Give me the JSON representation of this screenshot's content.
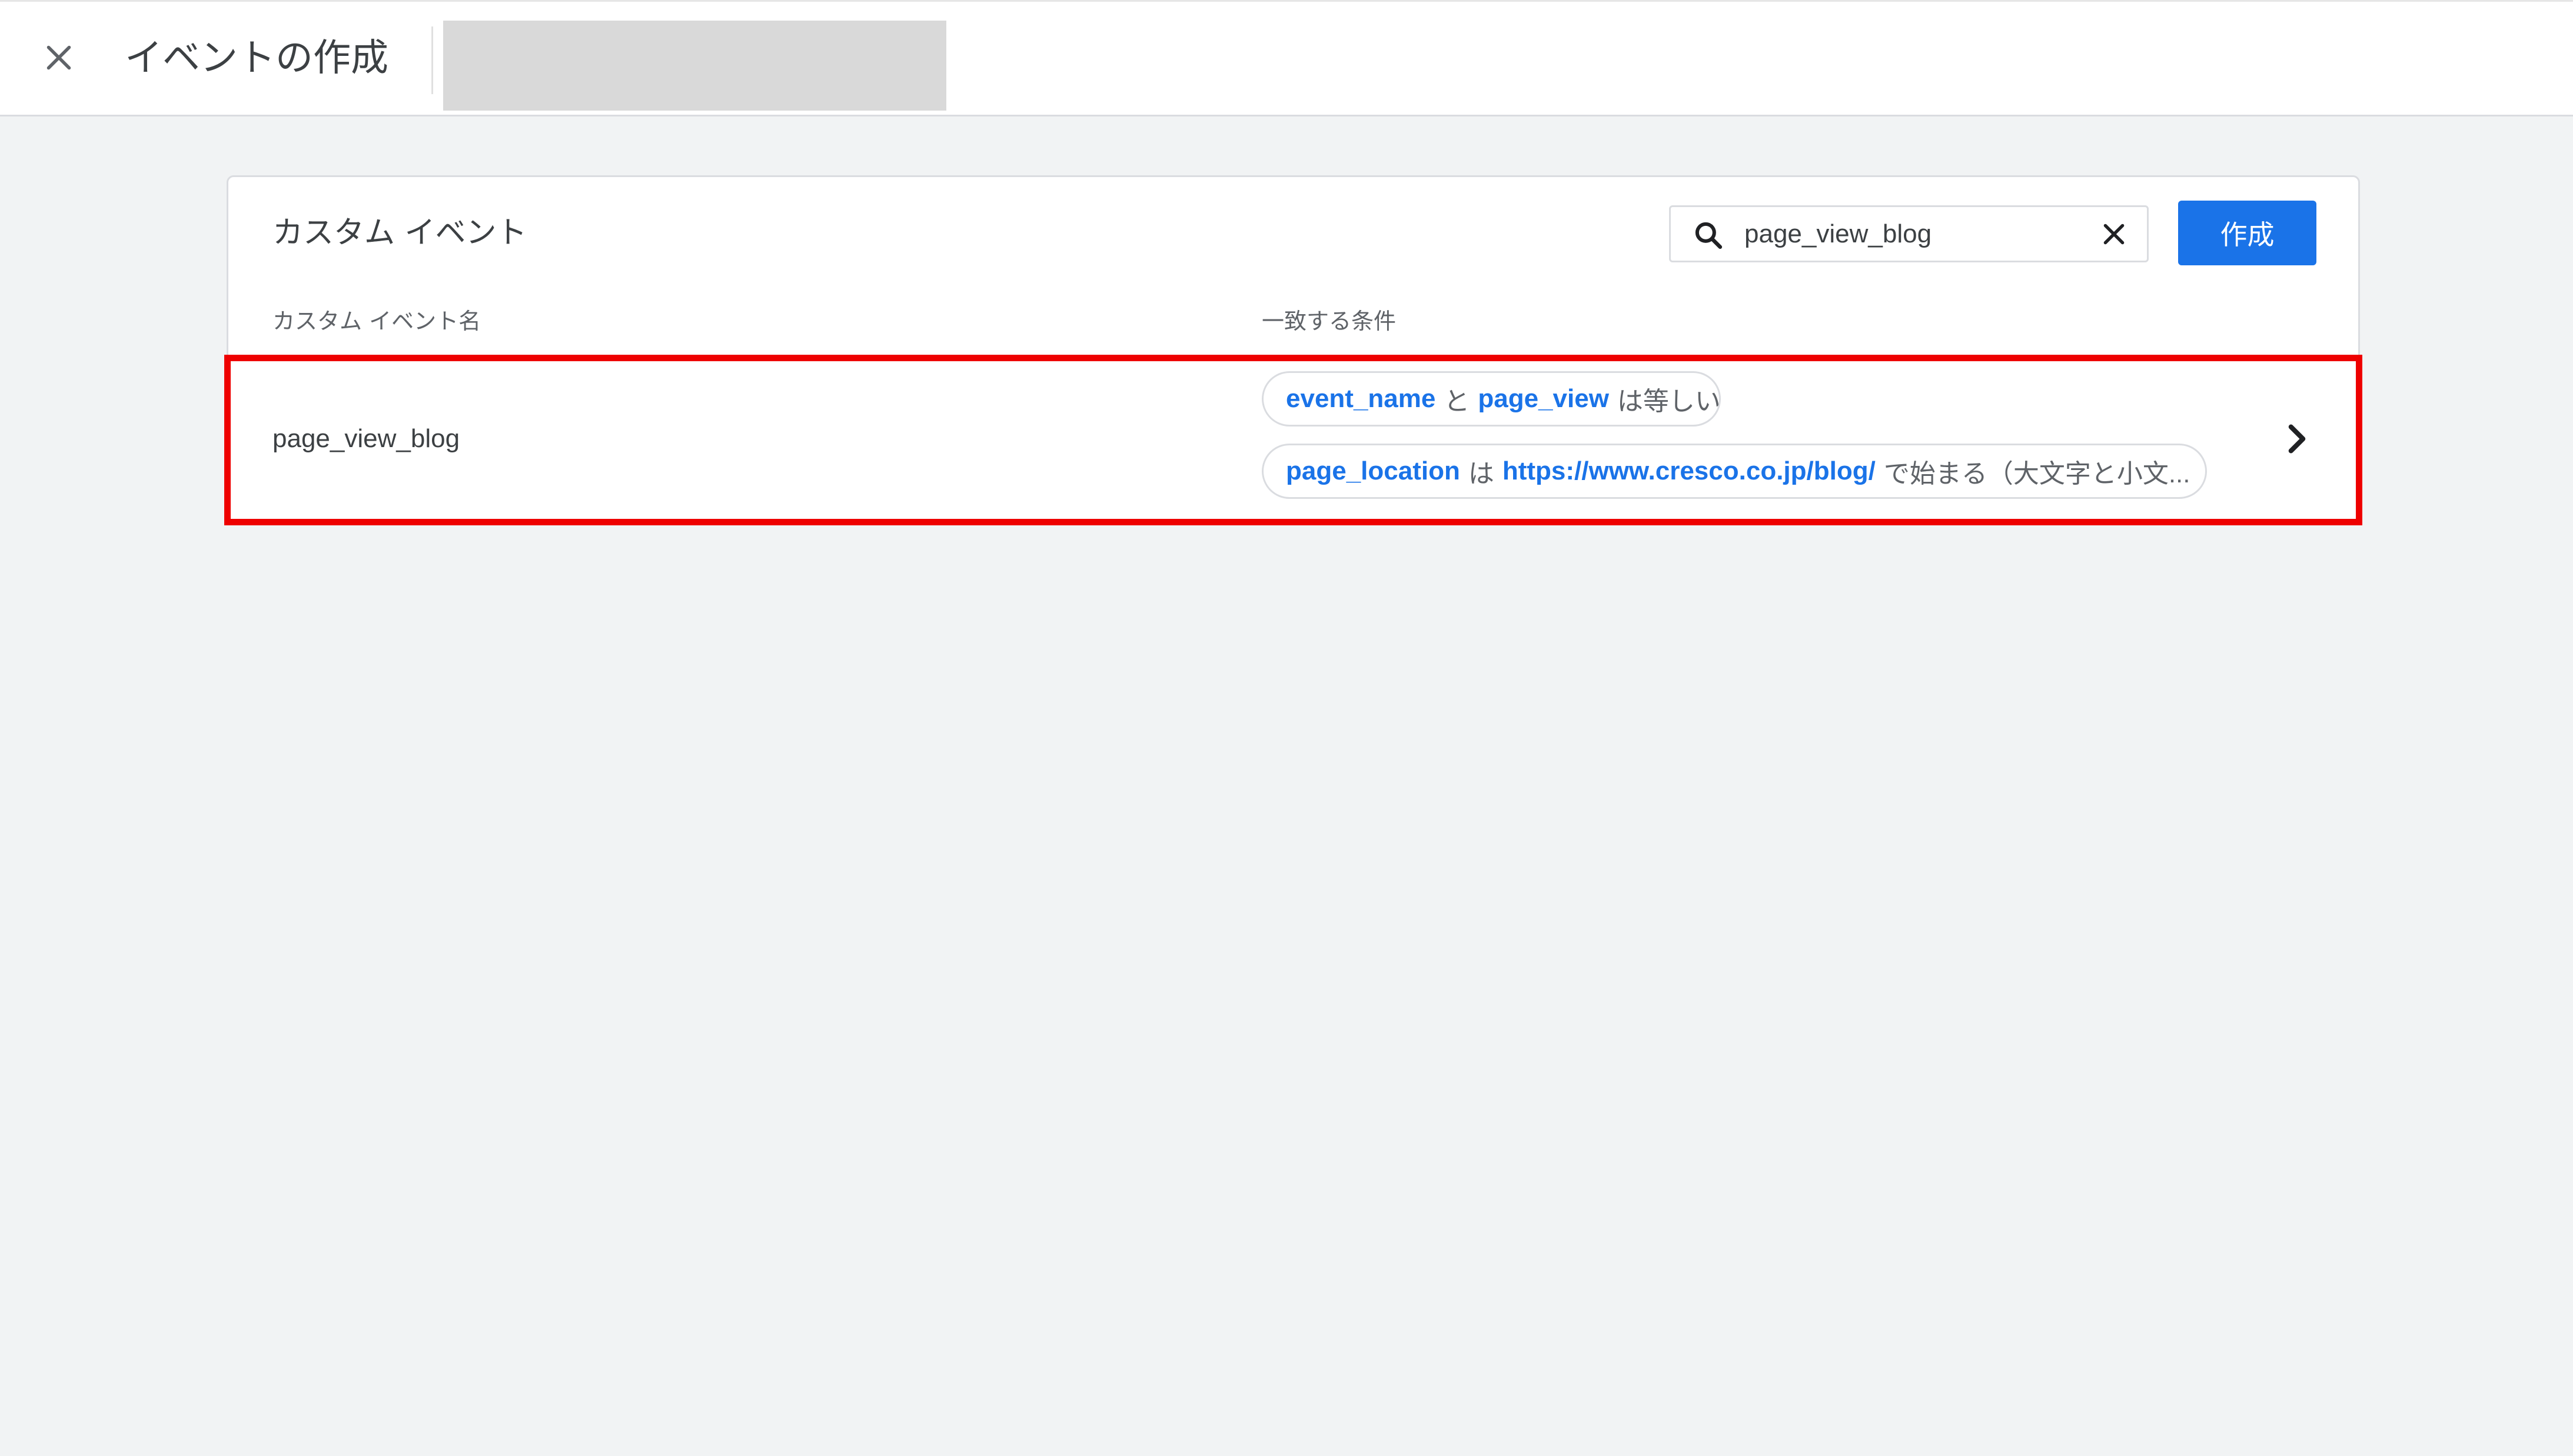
{
  "header": {
    "title": "イベントの作成",
    "close_icon": "close-icon"
  },
  "card": {
    "title": "カスタム イベント",
    "search": {
      "value": "page_view_blog",
      "search_icon": "search-icon",
      "clear_icon": "close-icon"
    },
    "create_label": "作成",
    "columns": [
      "カスタム イベント名",
      "一致する条件"
    ],
    "rows": [
      {
        "name": "page_view_blog",
        "conditions": [
          {
            "param": "event_name",
            "op1": "と",
            "value": "page_view",
            "op2": "は等しい"
          },
          {
            "param": "page_location",
            "op1": "は",
            "value": "https://www.cresco.co.jp/blog/",
            "op2": "で始まる（大文字と小文..."
          }
        ],
        "chevron_icon": "chevron-right-icon"
      }
    ]
  },
  "colors": {
    "accent": "#1a73e8",
    "highlight": "#ee0000",
    "background": "#f1f3f4"
  }
}
